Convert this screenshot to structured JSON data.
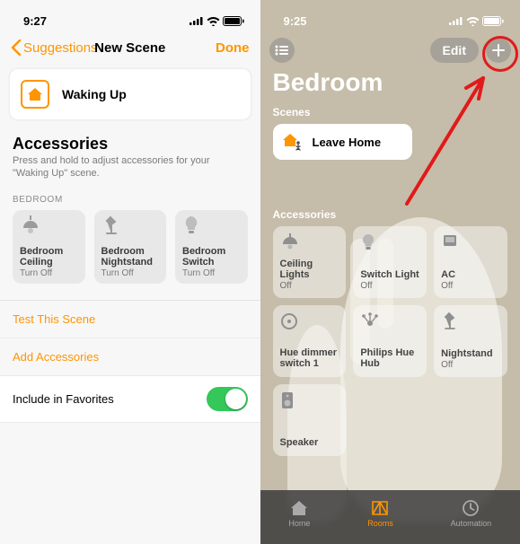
{
  "left": {
    "status_time": "9:27",
    "nav_back": "Suggestions",
    "nav_title": "New Scene",
    "nav_done": "Done",
    "scene_name": "Waking Up",
    "accessories_heading": "Accessories",
    "accessories_sub": "Press and hold to adjust accessories for your \"Waking Up\" scene.",
    "room_label": "BEDROOM",
    "tiles": [
      {
        "name": "Bedroom Ceiling Lig…",
        "state": "Turn Off",
        "icon": "ceiling-light"
      },
      {
        "name": "Bedroom Nightstand",
        "state": "Turn Off",
        "icon": "desk-lamp"
      },
      {
        "name": "Bedroom Switch Light",
        "state": "Turn Off",
        "icon": "bulb"
      }
    ],
    "link_test": "Test This Scene",
    "link_add": "Add Accessories",
    "toggle_label": "Include in Favorites"
  },
  "right": {
    "status_time": "9:25",
    "edit": "Edit",
    "room_title": "Bedroom",
    "scenes_label": "Scenes",
    "scene_name": "Leave Home",
    "accessories_label": "Accessories",
    "acc": [
      {
        "name": "Ceiling Lights",
        "state": "Off",
        "icon": "ceiling-light"
      },
      {
        "name": "Switch Light",
        "state": "Off",
        "icon": "bulb"
      },
      {
        "name": "AC",
        "state": "Off",
        "icon": "ac"
      },
      {
        "name": "Hue dimmer switch 1",
        "state": "",
        "icon": "dimmer"
      },
      {
        "name": "Philips Hue Hub",
        "state": "",
        "icon": "hub"
      },
      {
        "name": "Nightstand",
        "state": "Off",
        "icon": "desk-lamp"
      },
      {
        "name": "Speaker",
        "state": "",
        "icon": "speaker"
      }
    ],
    "tabs": [
      {
        "label": "Home",
        "active": false
      },
      {
        "label": "Rooms",
        "active": true
      },
      {
        "label": "Automation",
        "active": false
      }
    ]
  }
}
